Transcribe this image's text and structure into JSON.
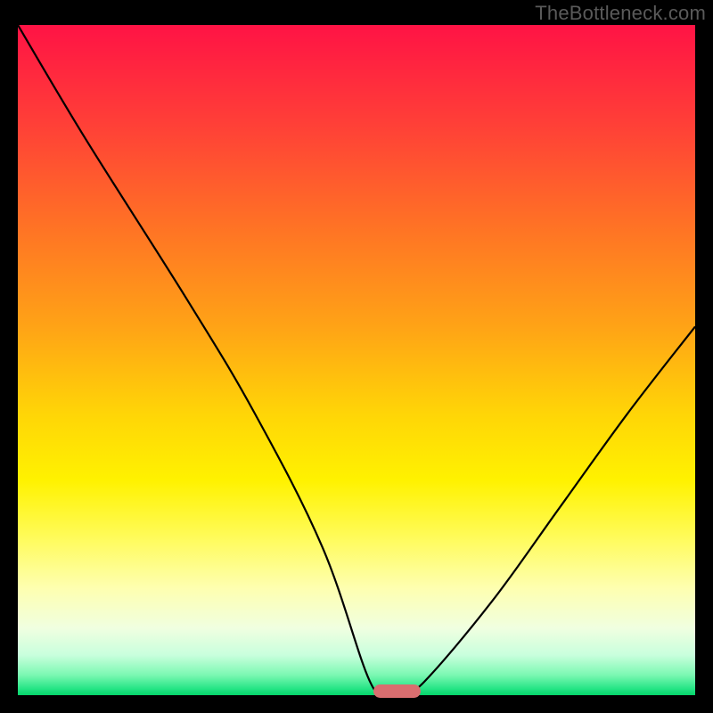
{
  "watermark": "TheBottleneck.com",
  "chart_data": {
    "type": "line",
    "title": "",
    "xlabel": "",
    "ylabel": "",
    "xlim": [
      0,
      100
    ],
    "ylim": [
      0,
      100
    ],
    "series": [
      {
        "name": "bottleneck-curve",
        "x": [
          0,
          10,
          25,
          35,
          45,
          52,
          55,
          57,
          60,
          70,
          80,
          90,
          100
        ],
        "y": [
          100,
          83,
          59,
          42,
          22,
          2,
          0.5,
          0.5,
          2,
          14,
          28,
          42,
          55
        ]
      }
    ],
    "marker": {
      "x_center": 56,
      "y": 0.5,
      "width_pct": 7
    },
    "background_gradient": {
      "stops": [
        {
          "pct": 0,
          "color": "#ff1345"
        },
        {
          "pct": 15,
          "color": "#ff4037"
        },
        {
          "pct": 30,
          "color": "#ff7225"
        },
        {
          "pct": 45,
          "color": "#ffa316"
        },
        {
          "pct": 58,
          "color": "#ffd507"
        },
        {
          "pct": 68,
          "color": "#fff200"
        },
        {
          "pct": 76,
          "color": "#fffb55"
        },
        {
          "pct": 84,
          "color": "#feffb0"
        },
        {
          "pct": 90,
          "color": "#f0ffe0"
        },
        {
          "pct": 94,
          "color": "#c9ffdd"
        },
        {
          "pct": 97,
          "color": "#7bf8b2"
        },
        {
          "pct": 99,
          "color": "#27e586"
        },
        {
          "pct": 100,
          "color": "#05d46b"
        }
      ]
    }
  }
}
